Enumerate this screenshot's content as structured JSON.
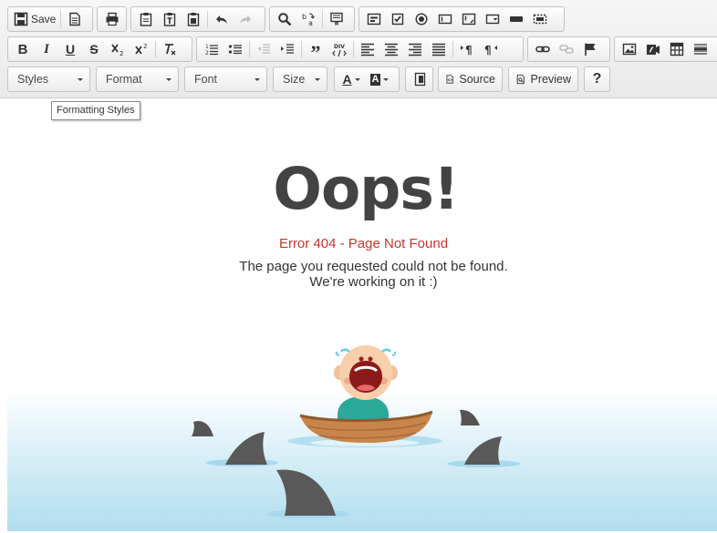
{
  "toolbar": {
    "save_label": "Save",
    "source_label": "Source",
    "preview_label": "Preview",
    "help_label": "?",
    "combos": {
      "styles": "Styles",
      "format": "Format",
      "font": "Font",
      "size": "Size"
    },
    "bold": "B",
    "italic": "I",
    "underline": "U",
    "strike": "S",
    "text_color_glyph": "A",
    "bg_color_glyph": "A"
  },
  "tooltip": "Formatting Styles",
  "page": {
    "heading": "Oops!",
    "error": "Error 404 - Page Not Found",
    "message_line1": "The page you requested could not be found.",
    "message_line2": "We're working on it :)"
  },
  "colors": {
    "error_red": "#c0392b",
    "heading_gray": "#434343",
    "sea_blue": "#b2ddee",
    "boat_brown": "#c8844a",
    "fin_gray": "#595959"
  }
}
